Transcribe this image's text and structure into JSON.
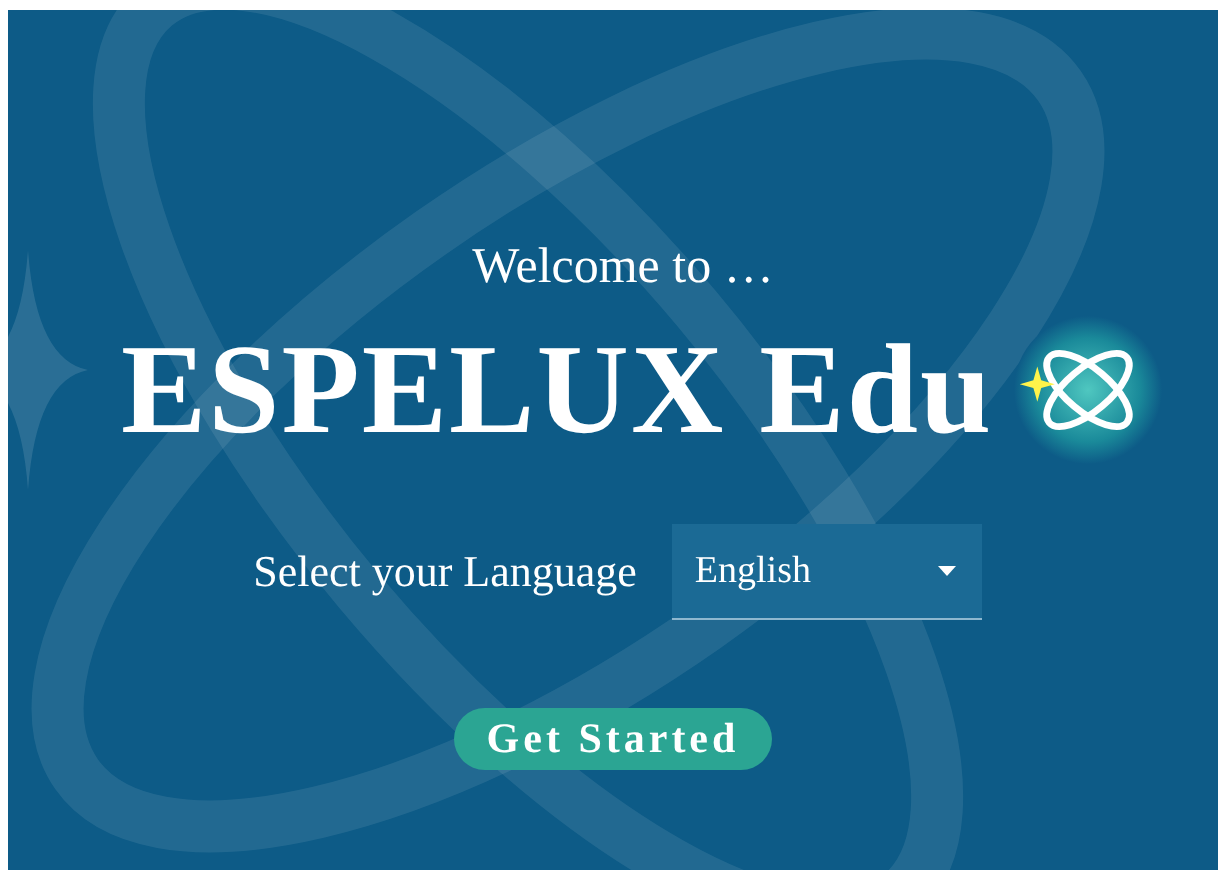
{
  "welcome": "Welcome to …",
  "title": "ESPELUX Edu",
  "language": {
    "label": "Select your Language",
    "value": "English"
  },
  "button": "Get Started"
}
